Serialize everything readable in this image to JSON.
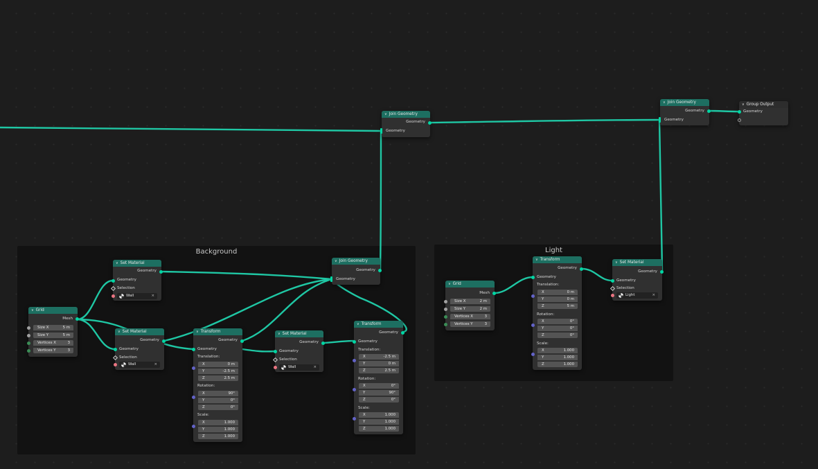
{
  "colors": {
    "geometry_wire": "#1fc7a4",
    "header": "#1d6f61",
    "frame": "#121212",
    "background": "#1d1d1d"
  },
  "icons": {
    "collapse": "chevron-down-icon",
    "material": "material-sphere-icon",
    "remove": "close-icon"
  },
  "frames": {
    "background": {
      "title": "Background"
    },
    "light": {
      "title": "Light"
    }
  },
  "labels": {
    "geometry": "Geometry",
    "mesh": "Mesh",
    "selection": "Selection",
    "translation": "Translation:",
    "rotation": "Rotation:",
    "scale": "Scale:",
    "size_x": "Size X",
    "size_y": "Size Y",
    "vertices_x": "Vertices X",
    "vertices_y": "Vertices Y",
    "x": "X",
    "y": "Y",
    "z": "Z",
    "close": "×"
  },
  "nodes": {
    "join1": {
      "title": "Join Geometry"
    },
    "join2": {
      "title": "Join Geometry"
    },
    "group_output": {
      "title": "Group Output"
    },
    "bg_join": {
      "title": "Join Geometry"
    },
    "bg_grid": {
      "title": "Grid",
      "size_x": "5 m",
      "size_y": "5 m",
      "vertices_x": "3",
      "vertices_y": "3"
    },
    "bg_setmat1": {
      "title": "Set Material",
      "material": "Wall"
    },
    "bg_setmat2": {
      "title": "Set Material",
      "material": "Wall"
    },
    "bg_setmat3": {
      "title": "Set Material",
      "material": "Wall"
    },
    "bg_transform1": {
      "title": "Transform",
      "translation": [
        "0 m",
        "-2.5 m",
        "2.5 m"
      ],
      "rotation": [
        "90°",
        "0°",
        "0°"
      ],
      "scale": [
        "1.000",
        "1.000",
        "1.000"
      ]
    },
    "bg_transform2": {
      "title": "Transform",
      "translation": [
        "-2.5 m",
        "0 m",
        "2.5 m"
      ],
      "rotation": [
        "0°",
        "90°",
        "0°"
      ],
      "scale": [
        "1.000",
        "1.000",
        "1.000"
      ]
    },
    "lt_grid": {
      "title": "Grid",
      "size_x": "2 m",
      "size_y": "2 m",
      "vertices_x": "3",
      "vertices_y": "3"
    },
    "lt_transform": {
      "title": "Transform",
      "translation": [
        "0 m",
        "0 m",
        "5 m"
      ],
      "rotation": [
        "0°",
        "0°",
        "0°"
      ],
      "scale": [
        "1.000",
        "1.000",
        "1.000"
      ]
    },
    "lt_setmat": {
      "title": "Set Material",
      "material": "Light"
    }
  }
}
